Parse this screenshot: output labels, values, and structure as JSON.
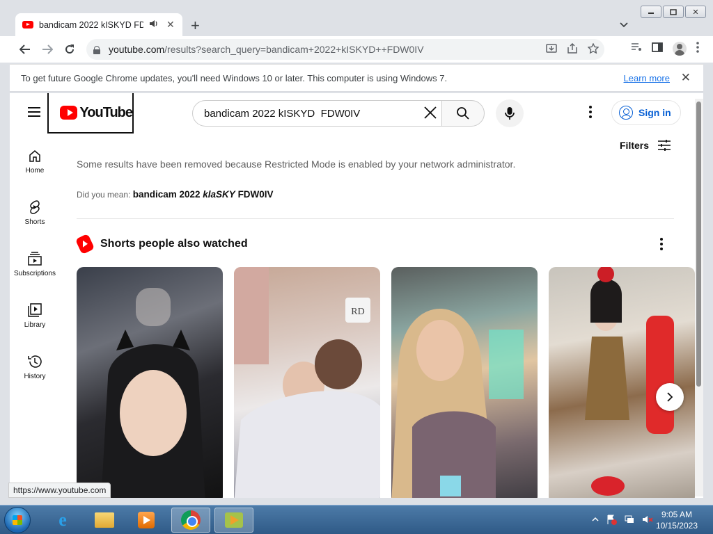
{
  "window": {
    "min": "▭",
    "max": "▢",
    "close": "✕"
  },
  "tab": {
    "title": "bandicam 2022 kISKYD FDW0IV",
    "close": "✕",
    "audio_icon": "speaker-icon"
  },
  "newtab": "+",
  "omnibox": {
    "url_host": "youtube.com",
    "url_path": "/results?search_query=bandicam+2022+kISKYD++FDW0IV"
  },
  "infobar": {
    "message": "To get future Google Chrome updates, you'll need Windows 10 or later. This computer is using Windows 7.",
    "link": "Learn more",
    "close": "✕"
  },
  "youtube": {
    "logo_text": "YouTube",
    "search_value": "bandicam 2022 kISKYD  FDW0IV",
    "search_placeholder": "Search",
    "signin": "Sign in",
    "filters": "Filters",
    "guide": [
      {
        "label": "Home"
      },
      {
        "label": "Shorts"
      },
      {
        "label": "Subscriptions"
      },
      {
        "label": "Library"
      },
      {
        "label": "History"
      }
    ],
    "restricted_notice": "Some results have been removed because Restricted Mode is enabled by your network administrator.",
    "did_you_mean_label": "Did you mean:",
    "did_you_mean_prefix": "bandicam 2022 ",
    "did_you_mean_italic": "klaSKY",
    "did_you_mean_suffix": " FDW0IV",
    "shorts_title": "Shorts people also watched",
    "thumb_watermark": "RD"
  },
  "status_url": "https://www.youtube.com",
  "taskbar": {
    "time": "9:05 AM",
    "date": "10/15/2023",
    "ie_glyph": "e"
  }
}
